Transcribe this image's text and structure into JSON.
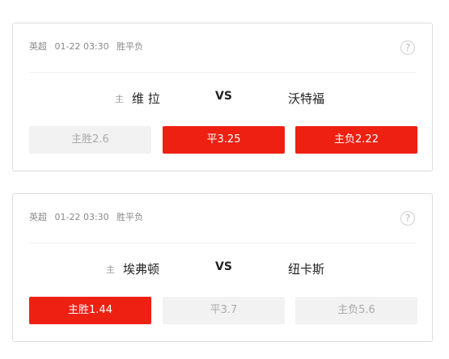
{
  "colors": {
    "selected": "#ee2012",
    "unselected": "#f2f2f2"
  },
  "matches": [
    {
      "league": "英超",
      "time": "01-22 03:30",
      "market": "胜平负",
      "help_icon": "?",
      "home_tag": "主",
      "home": "维 拉",
      "vs": "VS",
      "away": "沃特福",
      "odds": [
        {
          "label": "主胜2.6",
          "selected": false
        },
        {
          "label": "平3.25",
          "selected": true
        },
        {
          "label": "主负2.22",
          "selected": true
        }
      ]
    },
    {
      "league": "英超",
      "time": "01-22 03:30",
      "market": "胜平负",
      "help_icon": "?",
      "home_tag": "主",
      "home": "埃弗顿",
      "vs": "VS",
      "away": "纽卡斯",
      "odds": [
        {
          "label": "主胜1.44",
          "selected": true
        },
        {
          "label": "平3.7",
          "selected": false
        },
        {
          "label": "主负5.6",
          "selected": false
        }
      ]
    }
  ]
}
